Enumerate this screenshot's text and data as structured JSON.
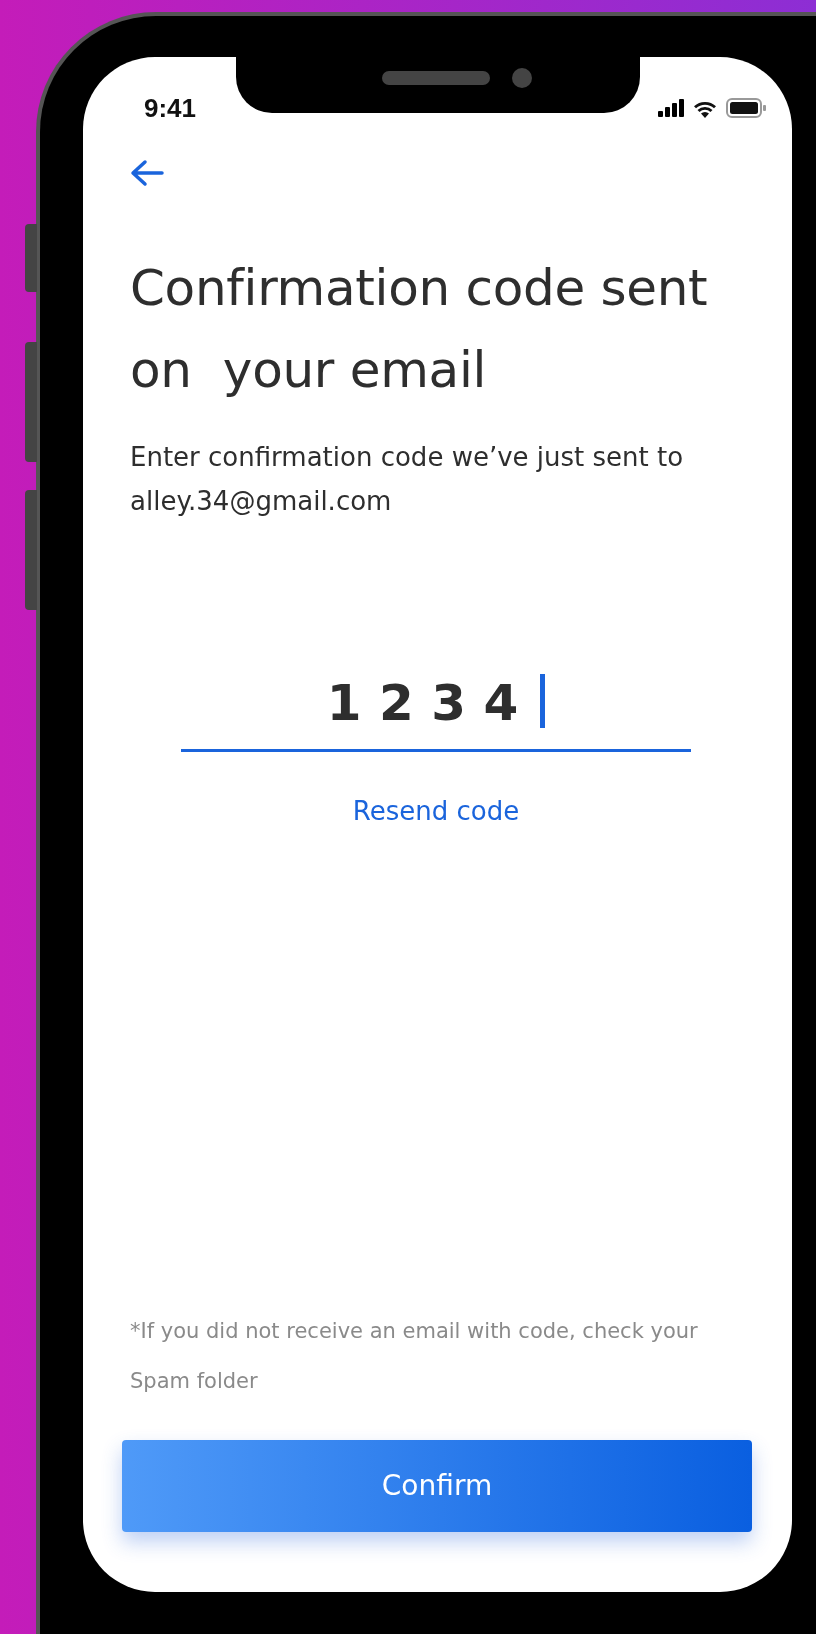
{
  "status_bar": {
    "time": "9:41"
  },
  "title_lines": [
    "Confirmation code sent",
    "on  your email"
  ],
  "instruction": "Enter confirmation code we’ve just sent to",
  "email": "alley.34@gmail.com",
  "code_field": {
    "value": "1 2 3 4",
    "focused": true
  },
  "resend_link": "Resend code",
  "note": "*If you did not receive an email with code, check your Spam folder",
  "confirm_button": "Confirm"
}
